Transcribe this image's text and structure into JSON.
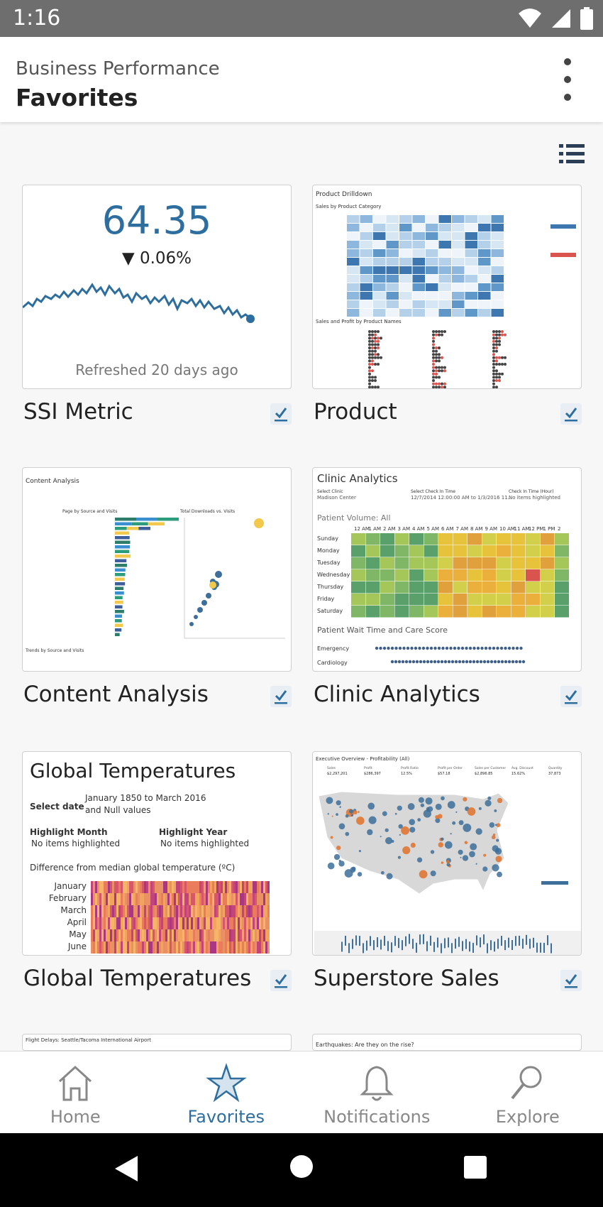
{
  "status": {
    "time": "1:16"
  },
  "header": {
    "subtitle": "Business Performance",
    "title": "Favorites"
  },
  "cards": [
    {
      "title": "SSI Metric",
      "metric": {
        "value": "64.35",
        "change": "▼ 0.06%",
        "refreshed": "Refreshed 20 days ago"
      }
    },
    {
      "title": "Product"
    },
    {
      "title": "Content Analysis"
    },
    {
      "title": "Clinic Analytics"
    },
    {
      "title": "Global Temperatures"
    },
    {
      "title": "Superstore Sales"
    }
  ],
  "thumbnails": {
    "product": {
      "heading": "Product Drilldown",
      "sub": "Sales by Product Category",
      "sub2": "Sales and Profit by Product Names"
    },
    "content": {
      "heading": "Content Analysis",
      "sub": "Page by Source and Visits",
      "sub2": "Total Downloads vs. Visits",
      "sub3": "Trends by Source and Visits"
    },
    "clinic": {
      "heading": "Clinic Analytics",
      "select_clinic": "Select Clinic",
      "clinic_value": "Madison Center",
      "select_time": "Select Check In Time",
      "time_value": "12/7/2014 12:00:00 AM to 1/3/2016 11..",
      "check_hour": "Check In Time (Hour)",
      "hour_value": "No items highlighted",
      "patient_volume": "Patient Volume: All",
      "wait_time": "Patient Wait Time and Care Score",
      "emergency": "Emergency",
      "cardiology": "Cardiology",
      "hours": [
        "12 AM",
        "1 AM",
        "2 AM",
        "3 AM",
        "4 AM",
        "5 AM",
        "6 AM",
        "7 AM",
        "8 AM",
        "9 AM",
        "10 AM",
        "11 AM",
        "12 PM",
        "1 PM",
        "2"
      ],
      "days": [
        "Sunday",
        "Monday",
        "Tuesday",
        "Wednesday",
        "Thursday",
        "Friday",
        "Saturday"
      ]
    },
    "global": {
      "title": "Global Temperatures",
      "select_date": "Select date",
      "date_range": "January 1850 to March 2016",
      "date_extra": "and Null values",
      "highlight_month": "Highlight Month",
      "highlight_year": "Highlight Year",
      "no_items": "No items highlighted",
      "difference": "Difference from median global temperature (ºC)",
      "months": [
        "January",
        "February",
        "March",
        "April",
        "May",
        "June"
      ]
    },
    "superstore": {
      "heading": "Executive Overview - Profitability (All)"
    },
    "flight": {
      "heading": "Flight Delays: Seattle/Tacoma International Airport"
    },
    "earthquake": {
      "heading": "Earthquakes: Are they on the rise?"
    }
  },
  "nav": [
    {
      "label": "Home",
      "icon": "home-icon"
    },
    {
      "label": "Favorites",
      "icon": "star-icon"
    },
    {
      "label": "Notifications",
      "icon": "bell-icon"
    },
    {
      "label": "Explore",
      "icon": "search-icon"
    }
  ],
  "colors": {
    "accent": "#2e6e9e"
  }
}
